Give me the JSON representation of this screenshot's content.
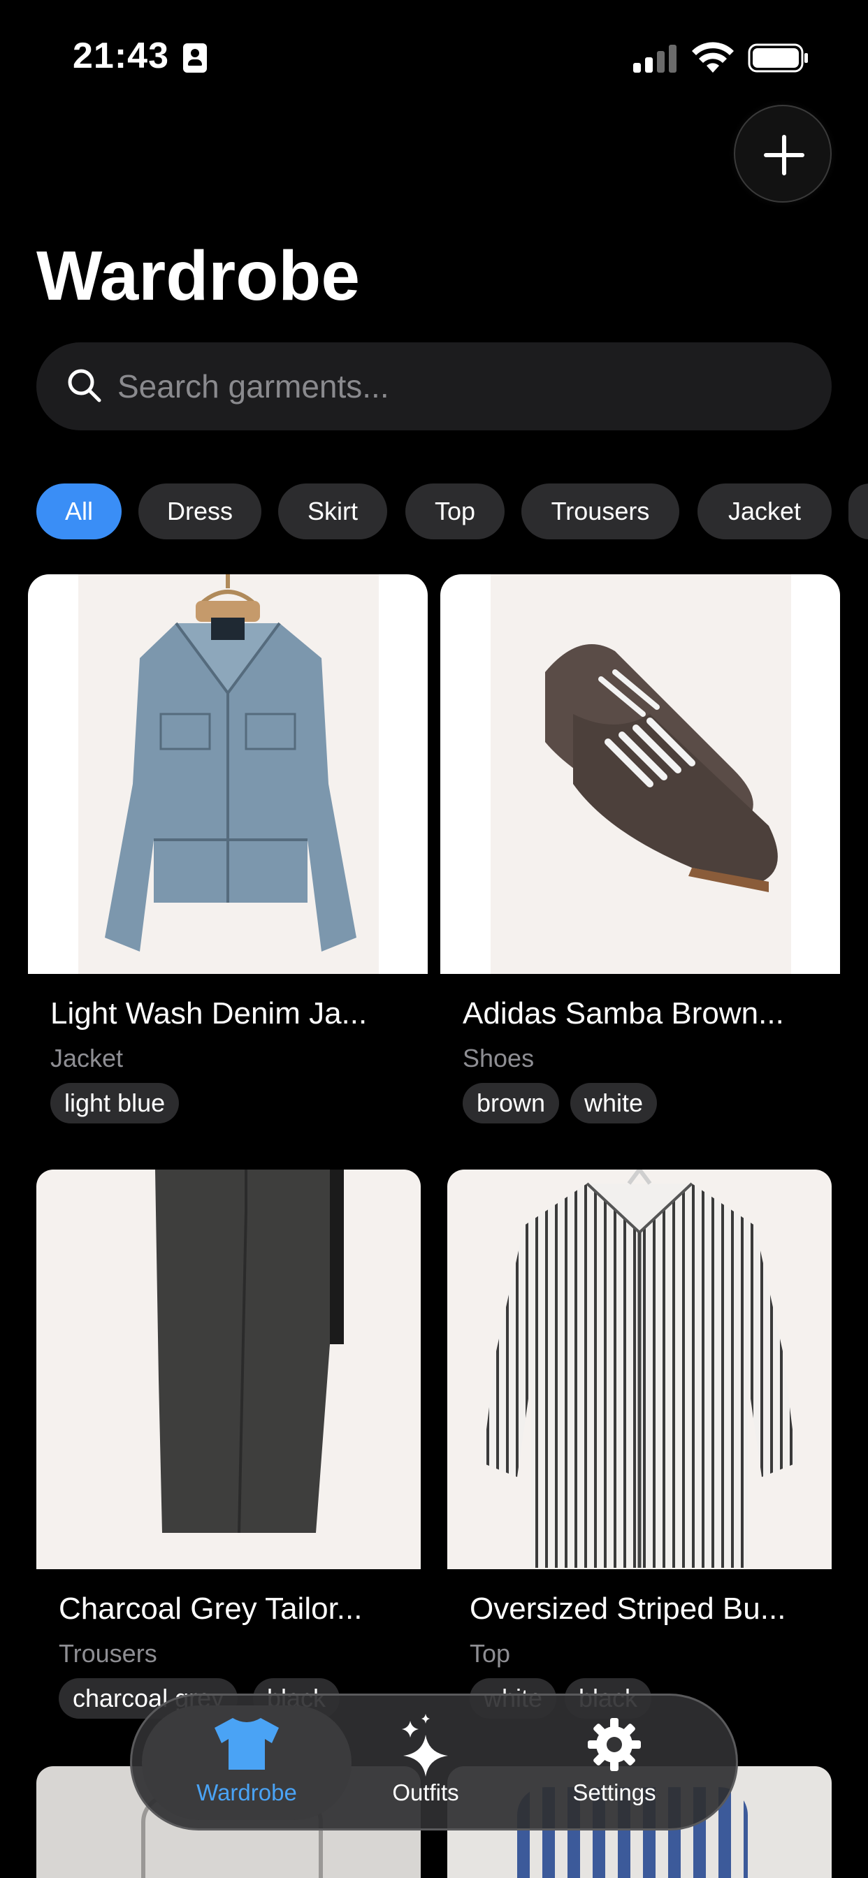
{
  "status_bar": {
    "time": "21:43"
  },
  "header": {
    "title": "Wardrobe"
  },
  "search": {
    "placeholder": "Search garments..."
  },
  "filters": [
    "All",
    "Dress",
    "Skirt",
    "Top",
    "Trousers",
    "Jacket"
  ],
  "active_filter": "All",
  "garments": [
    {
      "name": "Light Wash Denim Ja...",
      "category": "Jacket",
      "colors": [
        "light blue"
      ]
    },
    {
      "name": "Adidas Samba Brown...",
      "category": "Shoes",
      "colors": [
        "brown",
        "white"
      ]
    },
    {
      "name": "Charcoal Grey Tailor...",
      "category": "Trousers",
      "colors": [
        "charcoal grey",
        "black"
      ]
    },
    {
      "name": "Oversized Striped Bu...",
      "category": "Top",
      "colors": [
        "white",
        "black"
      ]
    }
  ],
  "tab_bar": {
    "wardrobe": "Wardrobe",
    "outfits": "Outfits",
    "settings": "Settings"
  },
  "colors": {
    "accent": "#3a8ef6",
    "background": "#000000",
    "surface": "#1c1c1e",
    "chip": "#2c2c2e",
    "tab_active": "#4aa3f5"
  }
}
